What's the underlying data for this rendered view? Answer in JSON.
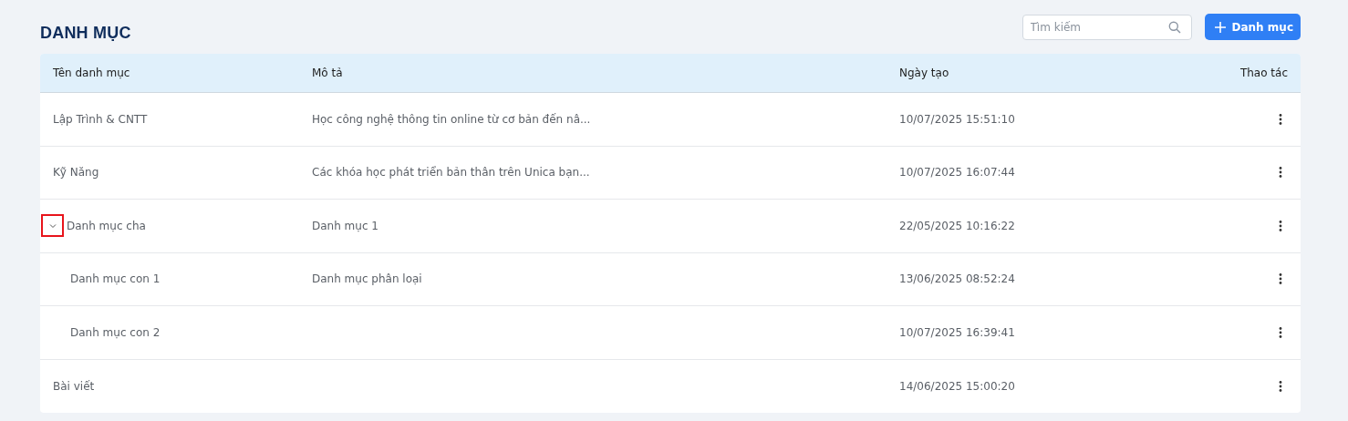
{
  "page": {
    "title": "DANH MỤC"
  },
  "search": {
    "placeholder": "Tìm kiếm"
  },
  "add_button": {
    "label": "Danh mục"
  },
  "table": {
    "columns": [
      "Tên danh mục",
      "Mô tả",
      "Ngày tạo",
      "Thao tác"
    ],
    "rows": [
      {
        "name": "Lập Trình & CNTT",
        "description": "Học công nghệ thông tin online từ cơ bản đến nâ...",
        "created": "10/07/2025 15:51:10"
      },
      {
        "name": "Kỹ Năng",
        "description": "Các khóa học phát triển bản thân trên Unica bạn...",
        "created": "10/07/2025 16:07:44"
      },
      {
        "name": "Danh mục cha",
        "description": "Danh mục 1",
        "created": "22/05/2025 10:16:22",
        "expanded": true,
        "highlighted": true,
        "children": [
          {
            "name": "Danh mục con 1",
            "description": "Danh mục phân loại",
            "created": "13/06/2025 08:52:24"
          },
          {
            "name": "Danh mục con 2",
            "created": "10/07/2025 16:39:41"
          }
        ]
      },
      {
        "name": "Bài viết",
        "created": "14/06/2025 15:00:20"
      }
    ]
  }
}
